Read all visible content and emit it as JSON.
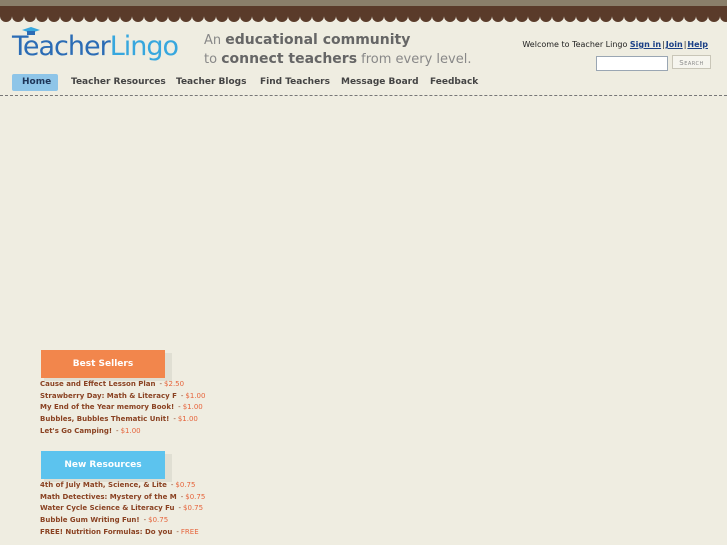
{
  "logo": {
    "part1": "Teacher",
    "part2": "Lingo"
  },
  "tagline": {
    "line1_pre": "An ",
    "line1_bold": "educational community",
    "line2_pre": "to ",
    "line2_bold": "connect teachers",
    "line2_post": " from every level."
  },
  "header": {
    "welcome_text": "Welcome to Teacher Lingo",
    "sign_in": "Sign in",
    "join": "Join",
    "help": "Help",
    "separator": "|",
    "search_placeholder": "",
    "search_button": "Search"
  },
  "nav": {
    "items": [
      {
        "label": "Home",
        "active": true
      },
      {
        "label": "Teacher Resources"
      },
      {
        "label": "Teacher Blogs"
      },
      {
        "label": "Find Teachers"
      },
      {
        "label": "Message Board"
      },
      {
        "label": "Feedback"
      }
    ]
  },
  "best_sellers": {
    "heading": "Best Sellers",
    "items": [
      {
        "title": "Cause and Effect Lesson Plan",
        "price": "$2.50"
      },
      {
        "title": "Strawberry Day: Math & Literacy F",
        "price": "$1.00"
      },
      {
        "title": "My End of the Year memory Book!",
        "price": "$1.00"
      },
      {
        "title": "Bubbles, Bubbles Thematic Unit!",
        "price": "$1.00"
      },
      {
        "title": "Let's Go Camping!",
        "price": "$1.00"
      }
    ]
  },
  "new_resources": {
    "heading": "New Resources",
    "items": [
      {
        "title": "4th of July Math, Science, & Lite",
        "price": "$0.75"
      },
      {
        "title": "Math Detectives: Mystery of the M",
        "price": "$0.75"
      },
      {
        "title": "Water Cycle Science & Literacy Fu",
        "price": "$0.75"
      },
      {
        "title": "Bubble Gum Writing Fun!",
        "price": "$0.75"
      },
      {
        "title": "FREE! Nutrition Formulas: Do you",
        "price": "FREE"
      }
    ]
  },
  "colors": {
    "background": "#efede1",
    "brown_band": "#5a3b2a",
    "logo_dark_blue": "#2b6cb5",
    "logo_light_blue": "#37a7de",
    "nav_active": "#8ec5e8",
    "best_sellers_tab": "#f2864c",
    "new_resources_tab": "#5cc3ee",
    "price": "#e6643b",
    "item_title": "#8a4222"
  }
}
